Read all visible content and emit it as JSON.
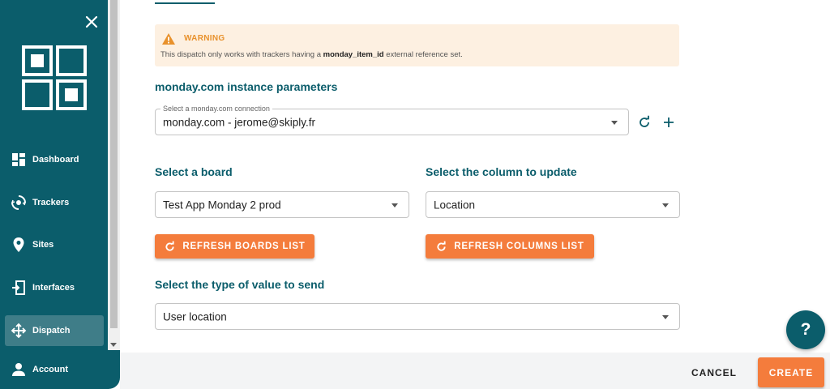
{
  "sidebar": {
    "items": [
      {
        "label": "Dashboard",
        "icon": "dashboard-icon"
      },
      {
        "label": "Trackers",
        "icon": "tracker-icon"
      },
      {
        "label": "Sites",
        "icon": "location-pin-icon"
      },
      {
        "label": "Interfaces",
        "icon": "interface-icon"
      },
      {
        "label": "Dispatch",
        "icon": "dispatch-icon",
        "active": true
      },
      {
        "label": "Account",
        "icon": "person-icon"
      }
    ]
  },
  "warning": {
    "title": "WARNING",
    "text_before": "This dispatch only works with trackers having a ",
    "text_bold": "monday_item_id",
    "text_after": " external reference set."
  },
  "instance": {
    "title": "monday.com instance parameters",
    "connection_legend": "Select a monday.com connection",
    "connection_value": "monday.com - jerome@skiply.fr"
  },
  "board": {
    "title": "Select a board",
    "value": "Test App Monday 2 prod",
    "refresh_label": "REFRESH BOARDS LIST"
  },
  "column": {
    "title": "Select the column to update",
    "value": "Location",
    "refresh_label": "REFRESH COLUMNS LIST"
  },
  "value_type": {
    "title": "Select the type of value to send",
    "value": "User location"
  },
  "footer": {
    "cancel_label": "CANCEL",
    "create_label": "CREATE"
  },
  "help": {
    "label": "?"
  },
  "colors": {
    "primary": "#0b5d6b",
    "accent": "#f47c3c",
    "warning_bg": "#fdf0e1",
    "warning_text": "#e8912c"
  }
}
